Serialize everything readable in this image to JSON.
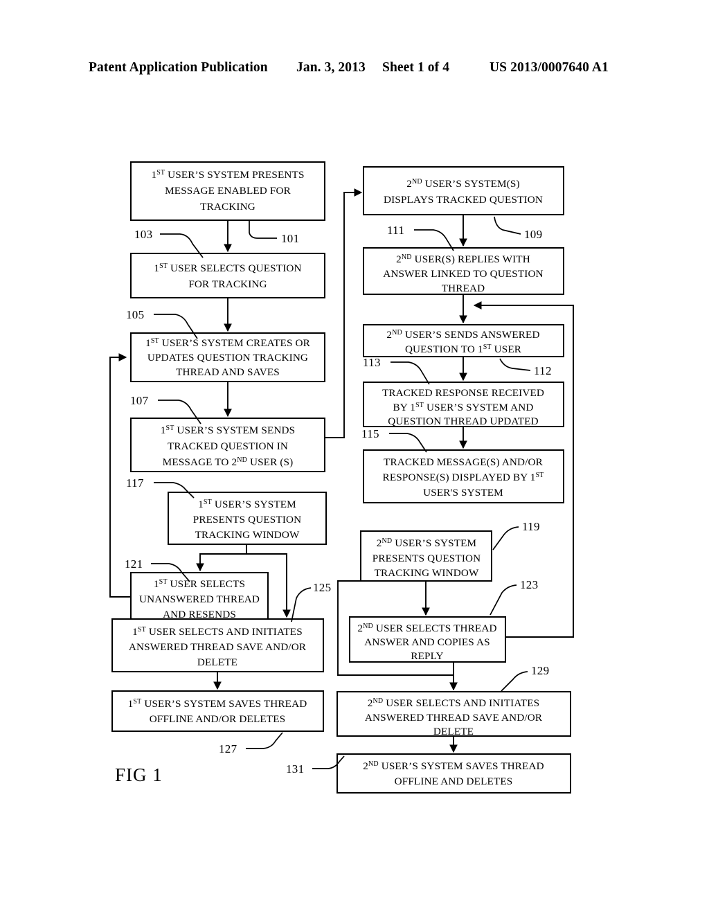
{
  "header": {
    "publication": "Patent Application Publication",
    "date": "Jan. 3, 2013",
    "sheet": "Sheet 1 of 4",
    "patent_number": "US 2013/0007640 A1"
  },
  "figure": {
    "label": "FIG 1",
    "type": "flowchart",
    "boxes": [
      {
        "id": "101",
        "ref": "101",
        "extra_ref": "103",
        "lines": [
          "1ST USER'S SYSTEM PRESENTS",
          "MESSAGE ENABLED FOR",
          "TRACKING"
        ]
      },
      {
        "id": "103",
        "ref": "103",
        "lines": [
          "1ST USER SELECTS QUESTION",
          "FOR TRACKING"
        ]
      },
      {
        "id": "105",
        "ref": "105",
        "lines": [
          "1ST USER'S SYSTEM CREATES OR",
          "UPDATES QUESTION TRACKING",
          "THREAD AND SAVES"
        ]
      },
      {
        "id": "107",
        "ref": "107",
        "lines": [
          "1ST USER'S SYSTEM SENDS",
          "TRACKED QUESTION IN",
          "MESSAGE TO 2ND USER (S)"
        ]
      },
      {
        "id": "117",
        "ref": "117",
        "lines": [
          "1ST USER'S SYSTEM",
          "PRESENTS QUESTION",
          "TRACKING WINDOW"
        ]
      },
      {
        "id": "121",
        "ref": "121",
        "lines": [
          "1ST USER SELECTS",
          "UNANSWERED THREAD",
          "AND RESENDS"
        ]
      },
      {
        "id": "125",
        "ref": "125",
        "lines": [
          "1ST USER SELECTS AND INITIATES",
          "ANSWERED THREAD SAVE AND/OR",
          "DELETE"
        ]
      },
      {
        "id": "127",
        "ref": "127",
        "lines": [
          "1ST USER'S SYSTEM SAVES THREAD",
          "OFFLINE AND/OR DELETES"
        ]
      },
      {
        "id": "109",
        "ref": "109",
        "extra_ref": "111",
        "lines": [
          "2ND USER'S SYSTEM(S)",
          "DISPLAYS TRACKED QUESTION"
        ]
      },
      {
        "id": "111",
        "ref": "111",
        "lines": [
          "2ND USER(S) REPLIES WITH",
          "ANSWER LINKED TO QUESTION",
          "THREAD"
        ]
      },
      {
        "id": "112",
        "ref": "112",
        "extra_ref": "113",
        "lines": [
          "2ND USER'S SENDS ANSWERED",
          "QUESTION TO 1ST USER"
        ]
      },
      {
        "id": "113",
        "ref": "113",
        "lines": [
          "TRACKED RESPONSE RECEIVED",
          "BY 1ST USER'S SYSTEM AND",
          "QUESTION THREAD UPDATED"
        ]
      },
      {
        "id": "115",
        "ref": "115",
        "lines": [
          "TRACKED MESSAGE(S) AND/OR",
          "RESPONSE(S)  DISPLAYED BY 1ST",
          "USER'S SYSTEM"
        ]
      },
      {
        "id": "119",
        "ref": "119",
        "lines": [
          "2ND USER'S SYSTEM",
          "PRESENTS QUESTION",
          "TRACKING WINDOW"
        ]
      },
      {
        "id": "123",
        "ref": "123",
        "lines": [
          "2ND USER SELECTS THREAD",
          "ANSWER AND COPIES AS",
          "REPLY"
        ]
      },
      {
        "id": "129",
        "ref": "129",
        "lines": [
          "2ND USER SELECTS AND INITIATES",
          "ANSWERED THREAD SAVE AND/OR",
          "DELETE"
        ]
      },
      {
        "id": "131",
        "ref": "131",
        "lines": [
          "2ND USER'S SYSTEM SAVES THREAD",
          "OFFLINE AND DELETES"
        ]
      }
    ],
    "reference_numerals": [
      "101",
      "103",
      "105",
      "107",
      "109",
      "111",
      "112",
      "113",
      "115",
      "117",
      "119",
      "121",
      "123",
      "125",
      "127",
      "129",
      "131"
    ]
  }
}
